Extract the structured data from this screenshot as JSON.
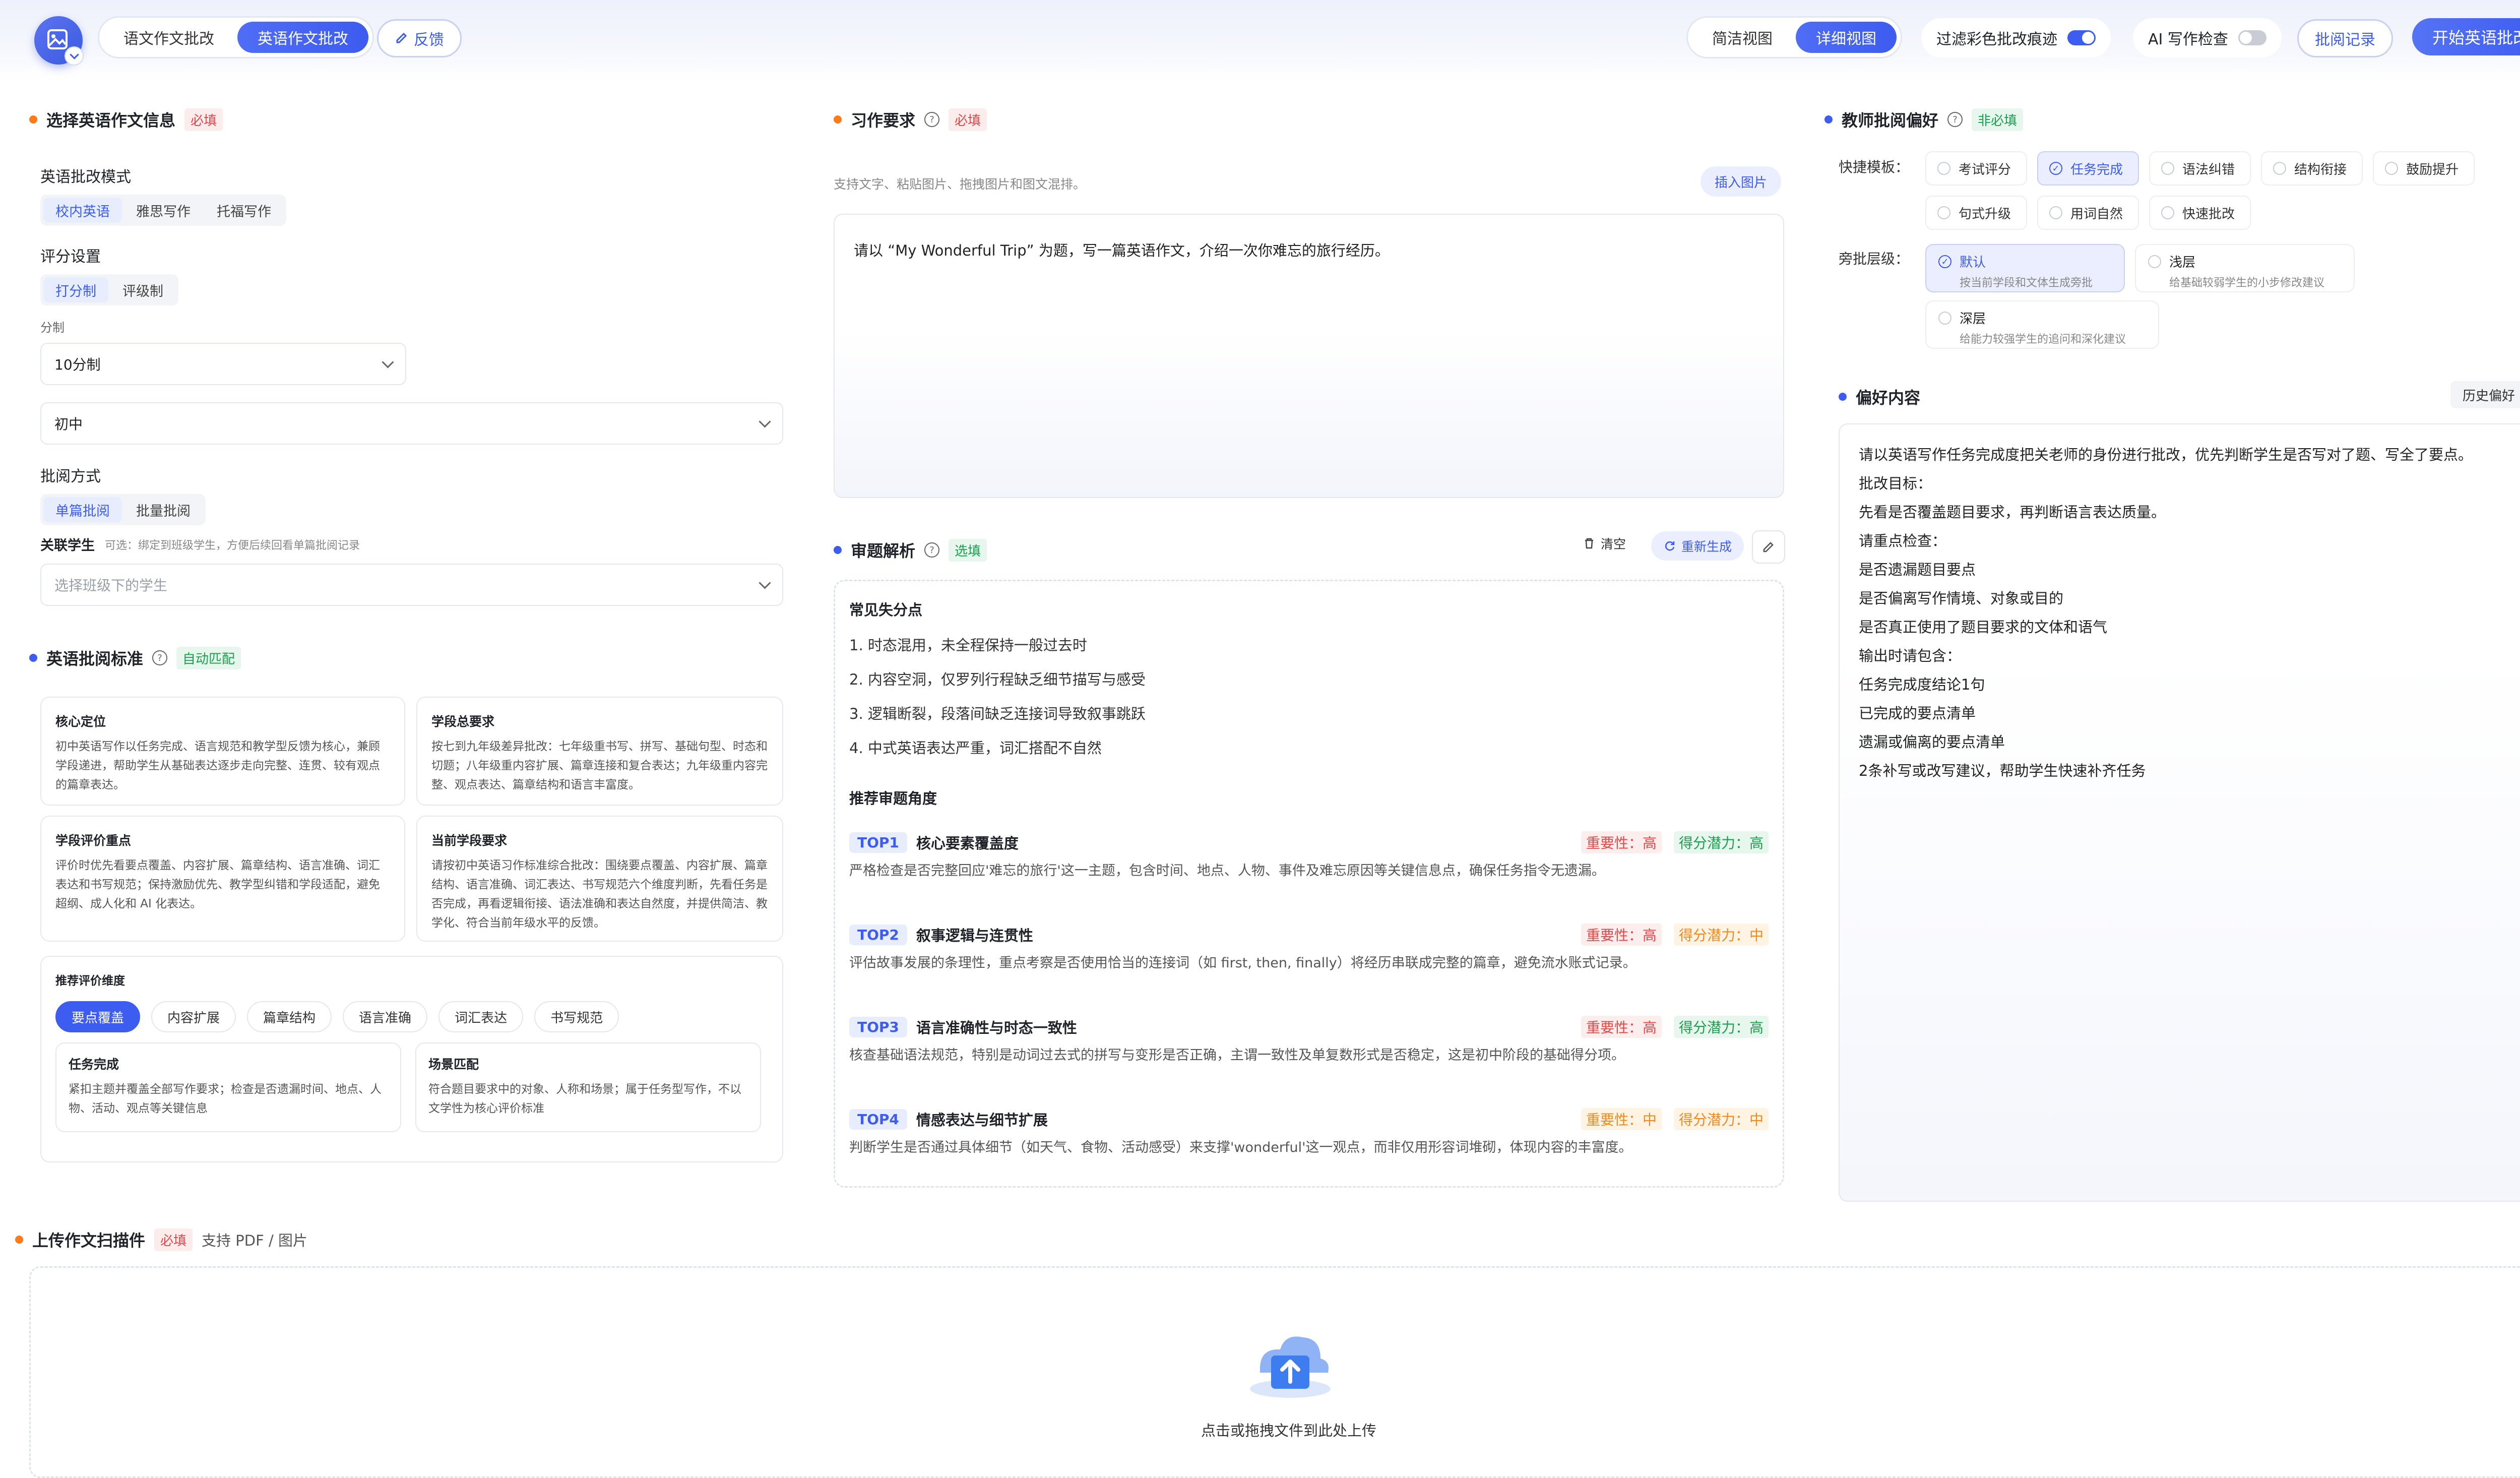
{
  "header": {
    "mode_tabs": [
      {
        "label": "语文作文批改",
        "active": false
      },
      {
        "label": "英语作文批改",
        "active": true
      }
    ],
    "feedback_label": "反馈",
    "view_tabs": [
      {
        "label": "简洁视图",
        "active": false
      },
      {
        "label": "详细视图",
        "active": true
      }
    ],
    "filter_toggle_label": "过滤彩色批改痕迹",
    "filter_toggle_on": true,
    "ai_check_label": "AI 写作检查",
    "ai_check_on": false,
    "history_label": "批阅记录",
    "start_label": "开始英语批改"
  },
  "left": {
    "section1_title": "选择英语作文信息",
    "required_tag": "必填",
    "mode_label": "英语批改模式",
    "mode_tabs": [
      "校内英语",
      "雅思写作",
      "托福写作"
    ],
    "score_label": "评分设置",
    "score_tabs": [
      "打分制",
      "评级制"
    ],
    "fen_label": "分制",
    "fen_value": "10分制",
    "grade_value": "初中",
    "method_label": "批阅方式",
    "method_tabs": [
      "单篇批阅",
      "批量批阅"
    ],
    "student_label": "关联学生",
    "student_hint": "可选：绑定到班级学生，方便后续回看单篇批阅记录",
    "student_placeholder": "选择班级下的学生",
    "section2_title": "英语批阅标准",
    "auto_tag": "自动匹配",
    "standard_cards": [
      {
        "title": "核心定位",
        "body": "初中英语写作以任务完成、语言规范和教学型反馈为核心，兼顾学段递进，帮助学生从基础表达逐步走向完整、连贯、较有观点的篇章表达。"
      },
      {
        "title": "学段总要求",
        "body": "按七到九年级差异批改：七年级重书写、拼写、基础句型、时态和切题；八年级重内容扩展、篇章连接和复合表达；九年级重内容完整、观点表达、篇章结构和语言丰富度。"
      },
      {
        "title": "学段评价重点",
        "body": "评价时优先看要点覆盖、内容扩展、篇章结构、语言准确、词汇表达和书写规范；保持激励优先、教学型纠错和学段适配，避免超纲、成人化和 AI 化表达。"
      },
      {
        "title": "当前学段要求",
        "body": "请按初中英语习作标准综合批改：围绕要点覆盖、内容扩展、篇章结构、语言准确、词汇表达、书写规范六个维度判断，先看任务是否完成，再看逻辑衔接、语法准确和表达自然度，并提供简洁、教学化、符合当前年级水平的反馈。"
      }
    ],
    "dimension_title": "推荐评价维度",
    "dimension_chips": [
      "要点覆盖",
      "内容扩展",
      "篇章结构",
      "语言准确",
      "词汇表达",
      "书写规范"
    ],
    "dimension_cards": [
      {
        "title": "任务完成",
        "body": "紧扣主题并覆盖全部写作要求；检查是否遗漏时间、地点、人物、活动、观点等关键信息"
      },
      {
        "title": "场景匹配",
        "body": "符合题目要求中的对象、人称和场景；属于任务型写作，不以文学性为核心评价标准"
      }
    ]
  },
  "middle": {
    "req_title": "习作要求",
    "req_tag": "必填",
    "req_hint": "支持文字、粘贴图片、拖拽图片和图文混排。",
    "insert_image_label": "插入图片",
    "prompt_text": "请以 “My Wonderful Trip” 为题，写一篇英语作文，介绍一次你难忘的旅行经历。",
    "analysis_title": "审题解析",
    "analysis_tag": "选填",
    "clear_label": "清空",
    "regen_label": "重新生成",
    "mistakes_title": "常见失分点",
    "mistakes": [
      "1. 时态混用，未全程保持一般过去时",
      "2. 内容空洞，仅罗列行程缺乏细节描写与感受",
      "3. 逻辑断裂，段落间缺乏连接词导致叙事跳跃",
      "4. 中式英语表达严重，词汇搭配不自然"
    ],
    "angles_title": "推荐审题角度",
    "importance_prefix": "重要性：",
    "potential_prefix": "得分潜力：",
    "angles": [
      {
        "rank": "TOP1",
        "name": "核心要素覆盖度",
        "importance": "高",
        "potential": "高",
        "desc": "严格检查是否完整回应'难忘的旅行'这一主题，包含时间、地点、人物、事件及难忘原因等关键信息点，确保任务指令无遗漏。"
      },
      {
        "rank": "TOP2",
        "name": "叙事逻辑与连贯性",
        "importance": "高",
        "potential": "中",
        "desc": "评估故事发展的条理性，重点考察是否使用恰当的连接词（如 first, then, finally）将经历串联成完整的篇章，避免流水账式记录。"
      },
      {
        "rank": "TOP3",
        "name": "语言准确性与时态一致性",
        "importance": "高",
        "potential": "高",
        "desc": "核查基础语法规范，特别是动词过去式的拼写与变形是否正确，主谓一致性及单复数形式是否稳定，这是初中阶段的基础得分项。"
      },
      {
        "rank": "TOP4",
        "name": "情感表达与细节扩展",
        "importance": "中",
        "potential": "中",
        "desc": "判断学生是否通过具体细节（如天气、食物、活动感受）来支撑'wonderful'这一观点，而非仅用形容词堆砌，体现内容的丰富度。"
      }
    ]
  },
  "right": {
    "pref_title": "教师批阅偏好",
    "pref_tag": "非必填",
    "template_label": "快捷模板：",
    "templates": [
      {
        "label": "考试评分",
        "active": false
      },
      {
        "label": "任务完成",
        "active": true
      },
      {
        "label": "语法纠错",
        "active": false
      },
      {
        "label": "结构衔接",
        "active": false
      },
      {
        "label": "鼓励提升",
        "active": false
      },
      {
        "label": "句式升级",
        "active": false
      },
      {
        "label": "用词自然",
        "active": false
      },
      {
        "label": "快速批改",
        "active": false
      }
    ],
    "depth_label": "旁批层级：",
    "depths": [
      {
        "name": "默认",
        "desc": "按当前学段和文体生成旁批",
        "active": true
      },
      {
        "name": "浅层",
        "desc": "给基础较弱学生的小步修改建议",
        "active": false
      },
      {
        "name": "深层",
        "desc": "给能力较强学生的追问和深化建议",
        "active": false
      }
    ],
    "content_title": "偏好内容",
    "history_pref_label": "历史偏好",
    "content_lines": [
      "请以英语写作任务完成度把关老师的身份进行批改，优先判断学生是否写对了题、写全了要点。",
      "批改目标：",
      "先看是否覆盖题目要求，再判断语言表达质量。",
      "请重点检查：",
      "是否遗漏题目要点",
      "是否偏离写作情境、对象或目的",
      "是否真正使用了题目要求的文体和语气",
      "输出时请包含：",
      "任务完成度结论1句",
      "已完成的要点清单",
      "遗漏或偏离的要点清单",
      "2条补写或改写建议，帮助学生快速补齐任务"
    ]
  },
  "upload": {
    "title": "上传作文扫描件",
    "tag": "必填",
    "support": "支持 PDF / 图片",
    "drop_label": "点击或拖拽文件到此处上传"
  },
  "colors": {
    "accent": "#3d5cf0",
    "required": "#e54848",
    "optional": "#1aa04e",
    "warn": "#f08a1c"
  }
}
